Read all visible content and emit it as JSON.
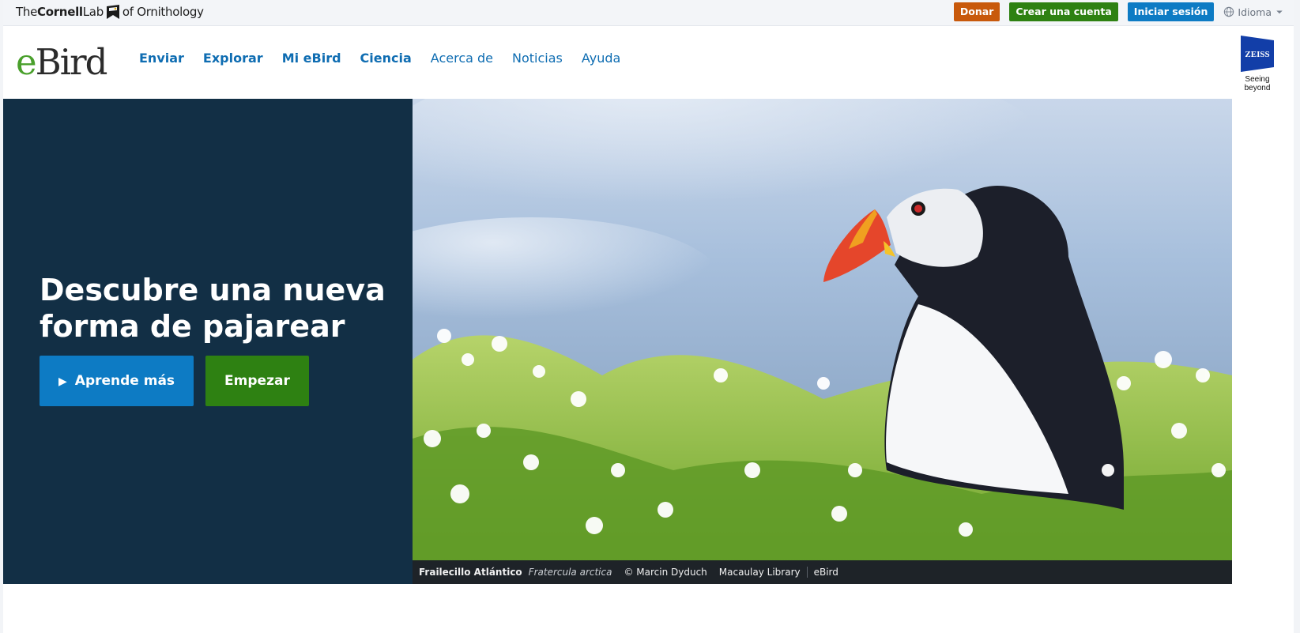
{
  "topbar": {
    "org_logo": {
      "prefix": "The",
      "strong": "Cornell",
      "mid": "Lab",
      "suffix": "of Ornithology"
    },
    "donate_label": "Donar",
    "create_account_label": "Crear una cuenta",
    "signin_label": "Iniciar sesión",
    "language_label": "Idioma",
    "colors": {
      "donate": "#c8590c",
      "create": "#2e8112",
      "signin": "#0d7bc4"
    }
  },
  "header": {
    "logo": {
      "e": "e",
      "rest": "Bird"
    },
    "nav": [
      {
        "label": "Enviar"
      },
      {
        "label": "Explorar"
      },
      {
        "label": "Mi eBird"
      },
      {
        "label": "Ciencia"
      },
      {
        "label": "Acerca de"
      },
      {
        "label": "Noticias"
      },
      {
        "label": "Ayuda"
      }
    ],
    "sponsor": {
      "name": "ZEISS",
      "tagline": "Seeing beyond"
    }
  },
  "hero": {
    "title_line1": "Descubre una nueva",
    "title_line2": "forma de pajarear",
    "learn_more_label": "Aprende más",
    "start_label": "Empezar",
    "caption": {
      "common_name": "Frailecillo Atlántico",
      "scientific_name": "Fratercula arctica",
      "credit": "© Marcin Dyduch",
      "library": "Macaulay Library",
      "source": "eBird"
    },
    "colors": {
      "panel": "#122f45"
    }
  }
}
